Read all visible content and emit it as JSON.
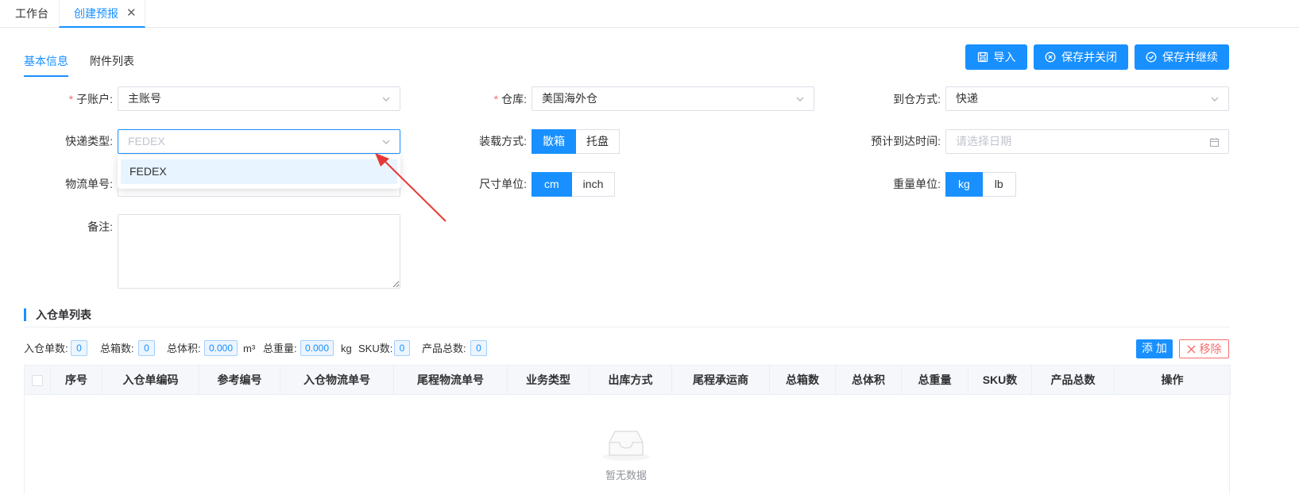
{
  "page_tabs": [
    {
      "label": "工作台"
    },
    {
      "label": "创建预报",
      "close": "✕"
    }
  ],
  "sub_tabs": [
    {
      "label": "基本信息"
    },
    {
      "label": "附件列表"
    }
  ],
  "actions": {
    "import": "导入",
    "save_close": "保存并关闭",
    "save_continue": "保存并继续"
  },
  "form": {
    "sub_account": {
      "label": "子账户:",
      "value": "主账号"
    },
    "warehouse": {
      "label": "仓库:",
      "value": "美国海外仓"
    },
    "arrival_method": {
      "label": "到仓方式:",
      "value": "快递"
    },
    "express_type": {
      "label": "快递类型:",
      "placeholder": "FEDEX",
      "options": [
        "FEDEX"
      ]
    },
    "loading_method": {
      "label": "装载方式:",
      "options": [
        "散箱",
        "托盘"
      ],
      "selected": "散箱"
    },
    "eta": {
      "label": "预计到达时间:",
      "placeholder": "请选择日期"
    },
    "tracking_no": {
      "label": "物流单号:"
    },
    "size_unit": {
      "label": "尺寸单位:",
      "options": [
        "cm",
        "inch"
      ],
      "selected": "cm"
    },
    "weight_unit": {
      "label": "重量单位:",
      "options": [
        "kg",
        "lb"
      ],
      "selected": "kg"
    },
    "remark": {
      "label": "备注:"
    }
  },
  "list": {
    "title": "入仓单列表",
    "stats": {
      "orders_label": "入仓单数:",
      "orders": "0",
      "boxes_label": "总箱数:",
      "boxes": "0",
      "volume_label": "总体积:",
      "volume": "0.000",
      "volume_unit": "m³",
      "weight_label": "总重量:",
      "weight": "0.000",
      "weight_unit": "kg",
      "sku_label": "SKU数:",
      "sku": "0",
      "products_label": "产品总数:",
      "products": "0"
    },
    "add": "添 加",
    "remove": "移除",
    "columns": [
      "序号",
      "入仓单编码",
      "参考编号",
      "入仓物流单号",
      "尾程物流单号",
      "业务类型",
      "出库方式",
      "尾程承运商",
      "总箱数",
      "总体积",
      "总重量",
      "SKU数",
      "产品总数",
      "操作"
    ],
    "empty": "暂无数据"
  },
  "colors": {
    "primary": "#1890ff",
    "danger": "#f56c6c"
  }
}
